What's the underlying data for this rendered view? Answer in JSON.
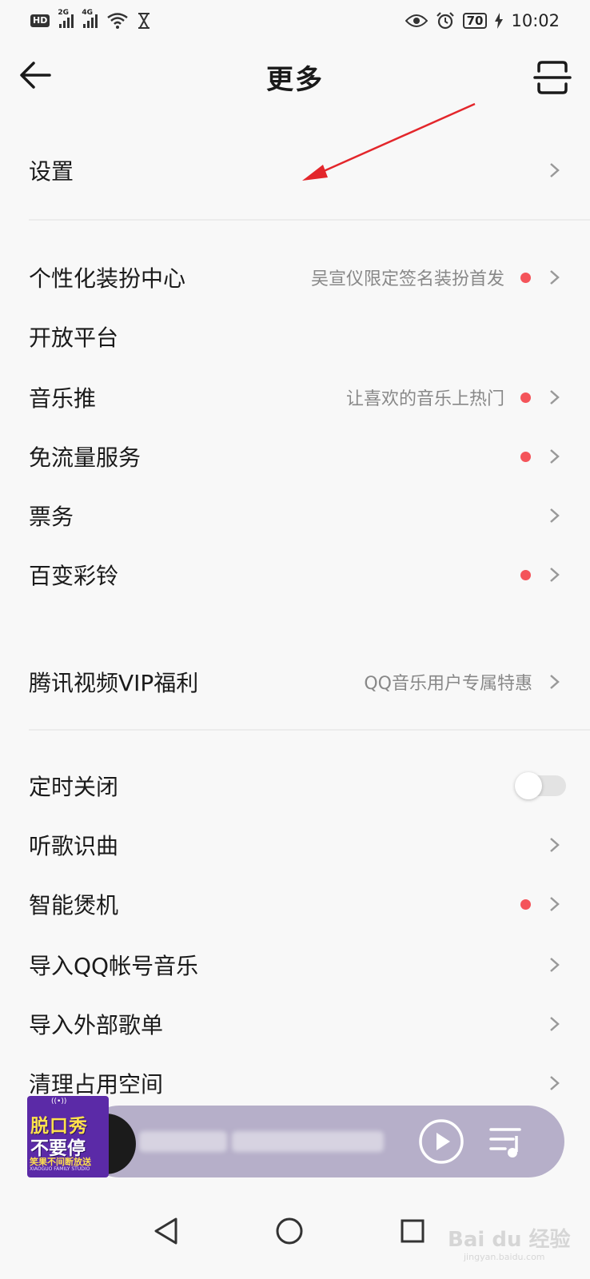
{
  "status_bar": {
    "hd_label": "HD",
    "sim1_label": "2G",
    "sim2_label": "4G",
    "battery": "70",
    "time": "10:02"
  },
  "header": {
    "title": "更多",
    "back_icon": "arrow-left-icon",
    "scan_icon": "scan-icon"
  },
  "rows": [
    {
      "label": "设置",
      "sub": "",
      "dot": false,
      "control": "chevron"
    },
    {
      "label": "个性化装扮中心",
      "sub": "吴宣仪限定签名装扮首发",
      "dot": true,
      "control": "chevron"
    },
    {
      "label": "开放平台",
      "sub": "",
      "dot": false,
      "control": "none"
    },
    {
      "label": "音乐推",
      "sub": "让喜欢的音乐上热门",
      "dot": true,
      "control": "chevron"
    },
    {
      "label": "免流量服务",
      "sub": "",
      "dot": true,
      "control": "chevron"
    },
    {
      "label": "票务",
      "sub": "",
      "dot": false,
      "control": "chevron"
    },
    {
      "label": "百变彩铃",
      "sub": "",
      "dot": true,
      "control": "chevron"
    },
    {
      "label": "腾讯视频VIP福利",
      "sub": "QQ音乐用户专属特惠",
      "dot": false,
      "control": "chevron"
    },
    {
      "label": "定时关闭",
      "sub": "",
      "dot": false,
      "control": "toggle",
      "toggle_on": false
    },
    {
      "label": "听歌识曲",
      "sub": "",
      "dot": false,
      "control": "chevron"
    },
    {
      "label": "智能煲机",
      "sub": "",
      "dot": true,
      "control": "chevron"
    },
    {
      "label": "导入QQ帐号音乐",
      "sub": "",
      "dot": false,
      "control": "chevron"
    },
    {
      "label": "导入外部歌单",
      "sub": "",
      "dot": false,
      "control": "chevron"
    },
    {
      "label": "清理占用空间",
      "sub": "",
      "dot": false,
      "control": "chevron"
    }
  ],
  "player": {
    "cover_line1": "脱口秀",
    "cover_line2": "不要停",
    "cover_line3": "笑果不间断放送",
    "cover_line4": "XIAOGUO FAMILY STUDIO",
    "play_icon": "play-icon",
    "queue_icon": "playlist-icon"
  },
  "watermark": {
    "text": "Bai du 经验",
    "sub": "jingyan.baidu.com"
  },
  "colors": {
    "background": "#f8f8f8",
    "red_dot": "#f4545a",
    "player_bg": "#b6afc9"
  }
}
